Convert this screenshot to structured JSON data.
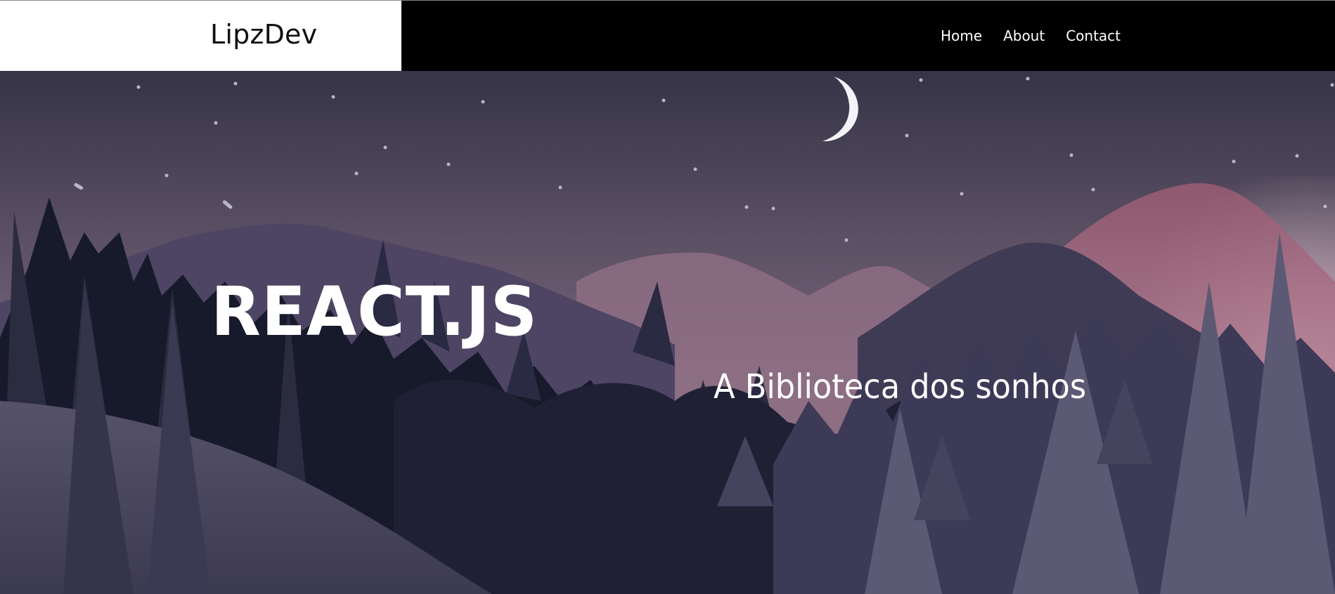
{
  "header": {
    "brand": "LipzDev",
    "nav": [
      "Home",
      "About",
      "Contact"
    ]
  },
  "hero": {
    "title": "REACT.JS",
    "subtitle": "A Biblioteca dos sonhos"
  },
  "colors": {
    "navbar_bg": "#000000",
    "brand_box_bg": "#ffffff",
    "text_on_dark": "#ffffff",
    "sky_top": "#383549",
    "sky_horizon": "#7a6878",
    "mountain_pink": "#a46b82",
    "tree_dark": "#151828",
    "tree_mid": "#3a3850"
  },
  "icons": [
    "moon-icon"
  ]
}
